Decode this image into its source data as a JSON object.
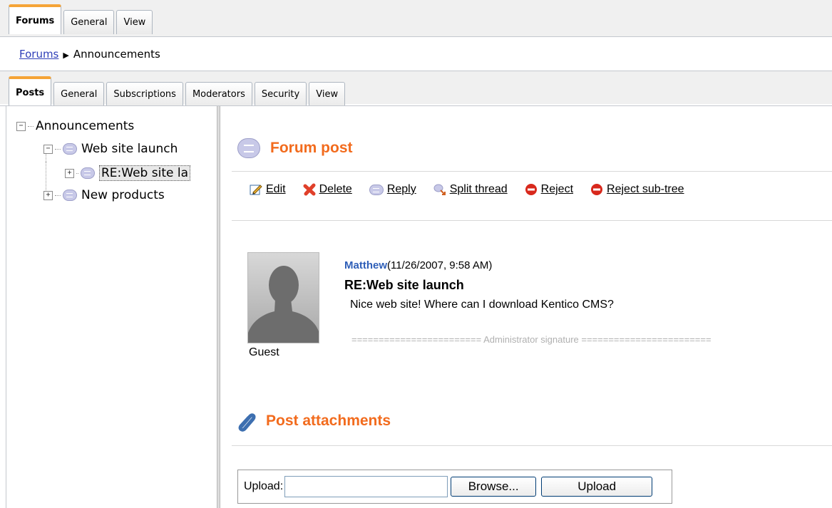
{
  "top_tabs": [
    {
      "label": "Forums",
      "active": true
    },
    {
      "label": "General",
      "active": false
    },
    {
      "label": "View",
      "active": false
    }
  ],
  "breadcrumb": {
    "root": "Forums",
    "current": "Announcements"
  },
  "sub_tabs": [
    {
      "label": "Posts",
      "active": true
    },
    {
      "label": "General",
      "active": false
    },
    {
      "label": "Subscriptions",
      "active": false
    },
    {
      "label": "Moderators",
      "active": false
    },
    {
      "label": "Security",
      "active": false
    },
    {
      "label": "View",
      "active": false
    }
  ],
  "tree": {
    "root": "Announcements",
    "thread1": "Web site launch",
    "reply1": "RE:Web site la",
    "thread2": "New products"
  },
  "forum_post": {
    "title": "Forum post",
    "actions": [
      "Edit",
      "Delete",
      "Reply",
      "Split thread",
      "Reject",
      "Reject sub-tree"
    ]
  },
  "post": {
    "author": "Matthew",
    "date": "(11/26/2007, 9:58 AM)",
    "subject": "RE:Web site launch",
    "body": "Nice web site! Where can I download Kentico CMS?",
    "signature": "======================== Administrator signature ========================",
    "user_label": "Guest"
  },
  "attachments": {
    "title": "Post attachments",
    "upload_label": "Upload:",
    "upload_value": "",
    "browse_label": "Browse...",
    "upload_button": "Upload"
  },
  "colors": {
    "accent": "#f26b1d",
    "link": "#2f3fb8",
    "tab_highlight": "#f5a437"
  }
}
